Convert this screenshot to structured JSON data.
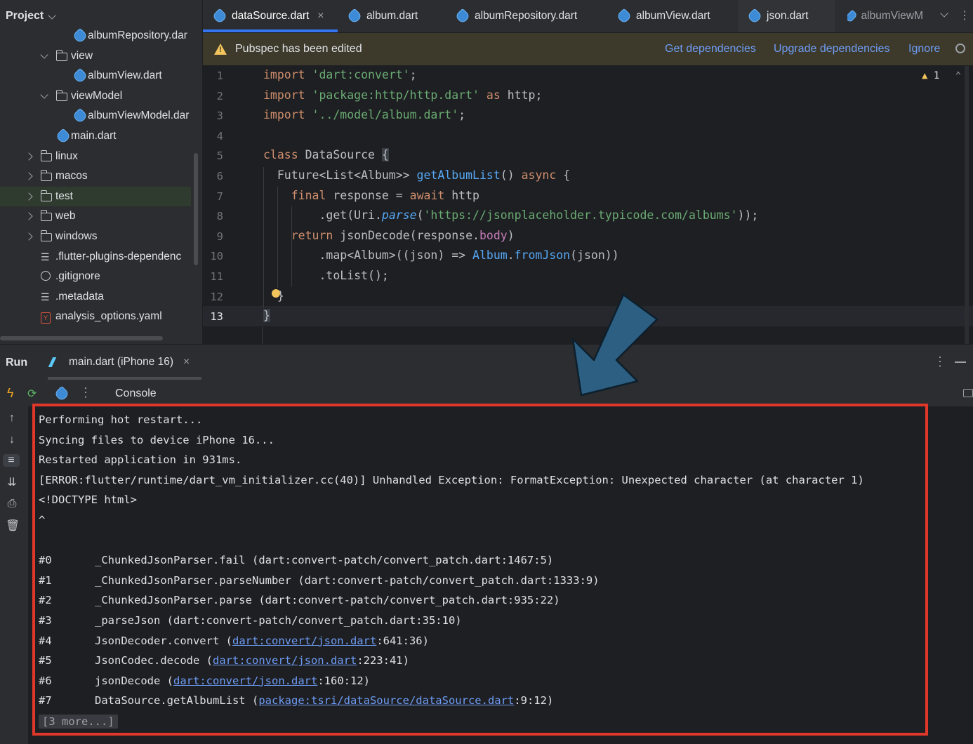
{
  "project": {
    "title": "Project",
    "items": [
      {
        "label": "albumRepository.dar",
        "type": "dart",
        "indent": 3,
        "expanded": null
      },
      {
        "label": "view",
        "type": "folder",
        "indent": 2,
        "expanded": true
      },
      {
        "label": "albumView.dart",
        "type": "dart",
        "indent": 3,
        "expanded": null
      },
      {
        "label": "viewModel",
        "type": "folder",
        "indent": 2,
        "expanded": true
      },
      {
        "label": "albumViewModel.dar",
        "type": "dart",
        "indent": 3,
        "expanded": null
      },
      {
        "label": "main.dart",
        "type": "dart",
        "indent": 2,
        "expanded": null
      },
      {
        "label": "linux",
        "type": "folder",
        "indent": 1,
        "expanded": false
      },
      {
        "label": "macos",
        "type": "folder",
        "indent": 1,
        "expanded": false
      },
      {
        "label": "test",
        "type": "folder-test",
        "indent": 1,
        "expanded": false
      },
      {
        "label": "web",
        "type": "folder-web",
        "indent": 1,
        "expanded": false
      },
      {
        "label": "windows",
        "type": "folder",
        "indent": 1,
        "expanded": false
      },
      {
        "label": ".flutter-plugins-dependenc",
        "type": "text",
        "indent": 1,
        "expanded": null
      },
      {
        "label": ".gitignore",
        "type": "ignore",
        "indent": 1,
        "expanded": null
      },
      {
        "label": ".metadata",
        "type": "text",
        "indent": 1,
        "expanded": null
      },
      {
        "label": "analysis_options.yaml",
        "type": "yaml",
        "indent": 1,
        "expanded": null
      }
    ]
  },
  "tabs": [
    {
      "label": "dataSource.dart",
      "active": true
    },
    {
      "label": "album.dart",
      "active": false
    },
    {
      "label": "albumRepository.dart",
      "active": false
    },
    {
      "label": "albumView.dart",
      "active": false
    },
    {
      "label": "json.dart",
      "active": false
    },
    {
      "label": "albumViewM",
      "active": false
    }
  ],
  "banner": {
    "text": "Pubspec has been edited",
    "get_deps": "Get dependencies",
    "upgrade_deps": "Upgrade dependencies",
    "ignore": "Ignore"
  },
  "editor": {
    "line_numbers": [
      "1",
      "2",
      "3",
      "4",
      "5",
      "6",
      "7",
      "8",
      "9",
      "10",
      "11",
      "12",
      "13"
    ],
    "current_line": 13,
    "inspection_count": "1"
  },
  "run": {
    "title": "Run",
    "config_tab": "main.dart (iPhone 16)",
    "console_label": "Console"
  },
  "console": {
    "lines": [
      "Performing hot restart...",
      "Syncing files to device iPhone 16...",
      "Restarted application in 931ms.",
      "[ERROR:flutter/runtime/dart_vm_initializer.cc(40)] Unhandled Exception: FormatException: Unexpected character (at character 1)",
      "<!DOCTYPE html>",
      "^",
      ""
    ],
    "stack": [
      {
        "num": "#0",
        "frame": "_ChunkedJsonParser.fail",
        "pre": "(dart:convert-patch/convert_patch.dart:1467:5)",
        "link": "",
        "post": ""
      },
      {
        "num": "#1",
        "frame": "_ChunkedJsonParser.parseNumber",
        "pre": "(dart:convert-patch/convert_patch.dart:1333:9)",
        "link": "",
        "post": ""
      },
      {
        "num": "#2",
        "frame": "_ChunkedJsonParser.parse",
        "pre": "(dart:convert-patch/convert_patch.dart:935:22)",
        "link": "",
        "post": ""
      },
      {
        "num": "#3",
        "frame": "_parseJson",
        "pre": "(dart:convert-patch/convert_patch.dart:35:10)",
        "link": "",
        "post": ""
      },
      {
        "num": "#4",
        "frame": "JsonDecoder.convert",
        "pre": "(",
        "link": "dart:convert/json.dart",
        "post": ":641:36)"
      },
      {
        "num": "#5",
        "frame": "JsonCodec.decode",
        "pre": "(",
        "link": "dart:convert/json.dart",
        "post": ":223:41)"
      },
      {
        "num": "#6",
        "frame": "jsonDecode",
        "pre": "(",
        "link": "dart:convert/json.dart",
        "post": ":160:12)"
      },
      {
        "num": "#7",
        "frame": "DataSource.getAlbumList",
        "pre": "(",
        "link": "package:tsri/dataSource/dataSource.dart",
        "post": ":9:12)"
      }
    ],
    "more": "[3 more...]"
  },
  "colors": {
    "accent": "#3574f0",
    "highlight_box": "#e0372b",
    "arrow": "#2c5f82"
  }
}
